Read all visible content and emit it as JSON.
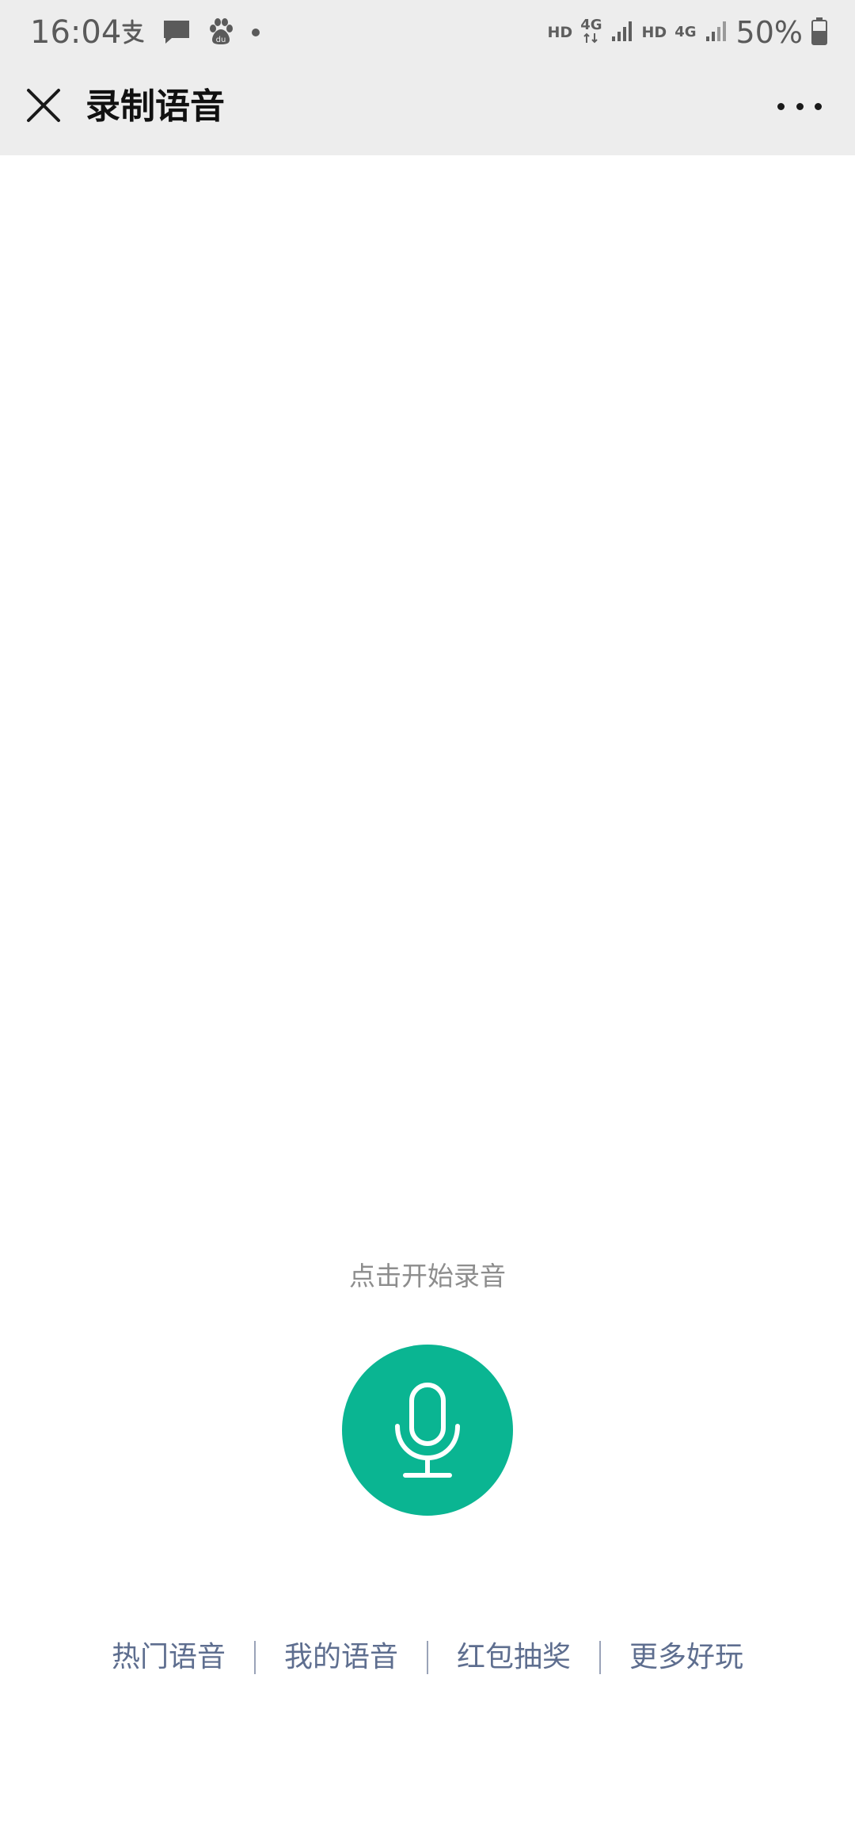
{
  "status_bar": {
    "time": "16:04",
    "left_icons": [
      "alipay-icon",
      "message-icon",
      "baidu-icon",
      "dot-icon"
    ],
    "hd1": "HD",
    "net1": "4G",
    "hd2": "HD",
    "net2": "4G",
    "battery": "50%"
  },
  "titlebar": {
    "title": "录制语音",
    "close_icon": "close-icon",
    "more_icon": "more-icon"
  },
  "recorder": {
    "hint": "点击开始录音",
    "mic_icon": "microphone-icon",
    "accent_color": "#0ab592"
  },
  "bottom_nav": {
    "items": [
      "热门语音",
      "我的语音",
      "红包抽奖",
      "更多好玩"
    ],
    "color": "#5e6e8f"
  }
}
